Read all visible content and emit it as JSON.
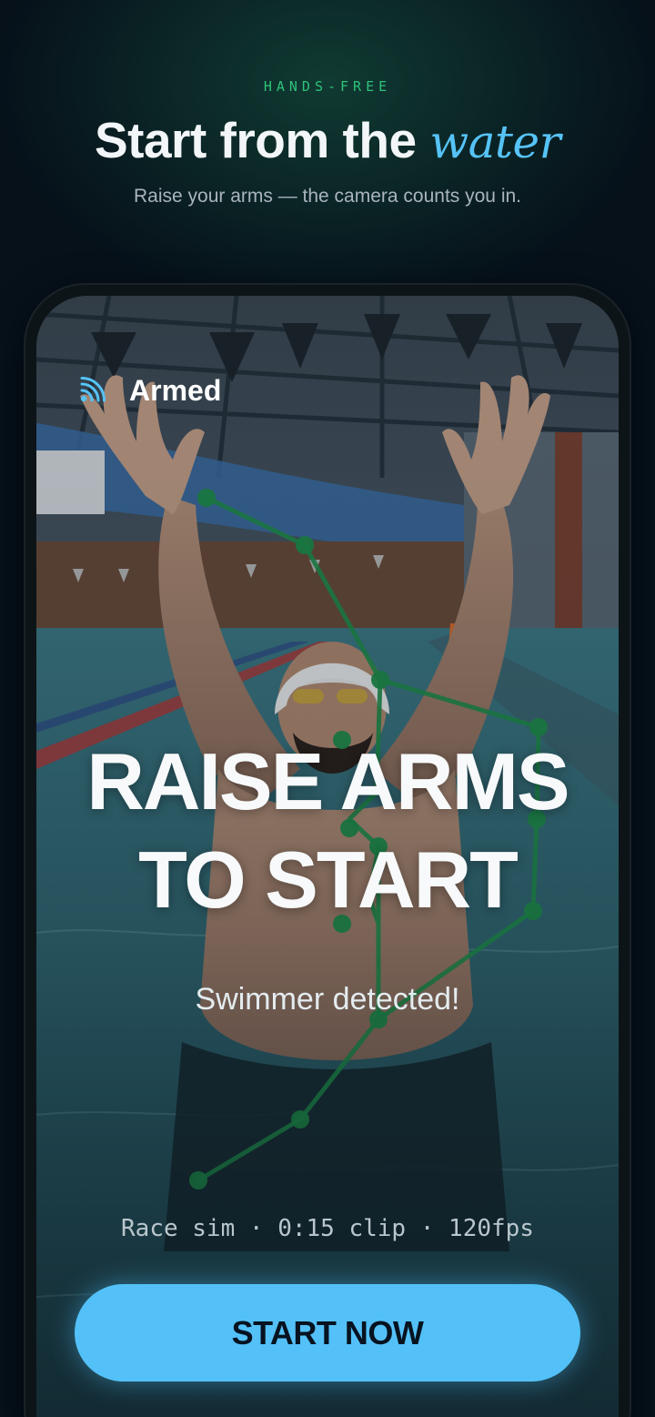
{
  "header": {
    "eyebrow": "HANDS-FREE",
    "headline_main": "Start from the ",
    "headline_accent": "water",
    "subline": "Raise your arms — the camera counts you in."
  },
  "camera": {
    "status_icon": "signal-broadcast-icon",
    "status_label": "Armed",
    "prompt_line1": "RAISE ARMS",
    "prompt_line2": "TO START",
    "detection_message": "Swimmer detected!",
    "clip_info": "Race sim · 0:15 clip · 120fps"
  },
  "actions": {
    "start_label": "START NOW"
  },
  "colors": {
    "background": "#06111a",
    "eyebrow": "#2ec27a",
    "accent": "#56c3f6",
    "cta": "#53c1f8",
    "skeleton": "#1f8f4a"
  }
}
